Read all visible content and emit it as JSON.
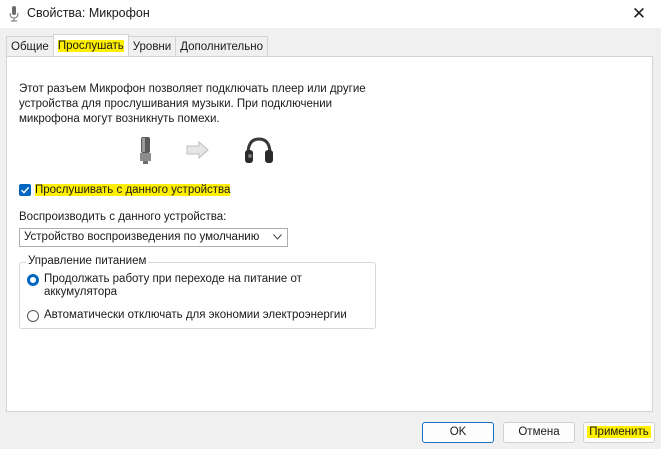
{
  "window": {
    "title": "Свойства: Микрофон",
    "close_glyph": "✕",
    "icon": "microphone-icon"
  },
  "tabs": [
    {
      "label": "Общие",
      "active": false
    },
    {
      "label": "Прослушать",
      "active": true,
      "highlighted": true
    },
    {
      "label": "Уровни",
      "active": false
    },
    {
      "label": "Дополнительно",
      "active": false
    }
  ],
  "listen": {
    "description_lines": [
      "Этот разъем Микрофон позволяет подключать плеер или другие",
      "устройства для прослушивания музыки. При подключении",
      "микрофона могут возникнуть помехи."
    ],
    "illustration": [
      "microphone-icon",
      "arrow-right-icon",
      "headphones-icon"
    ],
    "listen_checkbox": {
      "label": "Прослушивать с данного устройства",
      "checked": true,
      "highlighted": true
    },
    "playback_label": "Воспроизводить с данного устройства:",
    "playback_select": {
      "value": "Устройство воспроизведения по умолчанию"
    },
    "power": {
      "legend": "Управление питанием",
      "options": [
        {
          "lines": [
            "Продолжать работу при переходе на питание от",
            "аккумулятора"
          ],
          "selected": true
        },
        {
          "lines": [
            "Автоматически отключать для экономии электроэнергии"
          ],
          "selected": false
        }
      ]
    }
  },
  "buttons": {
    "ok": "OK",
    "cancel": "Отмена",
    "apply": "Применить"
  },
  "colors": {
    "accent": "#0067c0",
    "highlight": "#ffef00"
  }
}
